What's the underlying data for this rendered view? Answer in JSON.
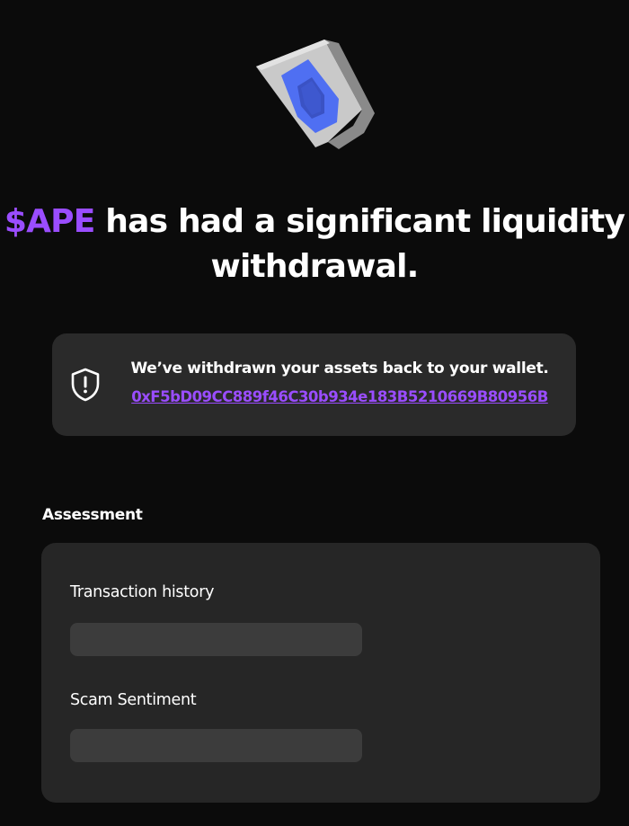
{
  "headline": {
    "token": "$APE",
    "rest_line1": " has had a significant liquidity",
    "rest_line2": "withdrawal."
  },
  "notice": {
    "icon": "shield-alert-icon",
    "message": "We’ve withdrawn your assets back to your wallet.",
    "wallet_address": "0xF5bD09CC889f46C30b934e183B5210669B80956B"
  },
  "assessment": {
    "title": "Assessment",
    "metrics": [
      {
        "label": "Transaction history"
      },
      {
        "label": "Scam Sentiment"
      }
    ]
  },
  "colors": {
    "accent": "#9a4dff",
    "background": "#0b0b0b",
    "card": "#2a2a2a",
    "bar": "#3c3c3c"
  }
}
